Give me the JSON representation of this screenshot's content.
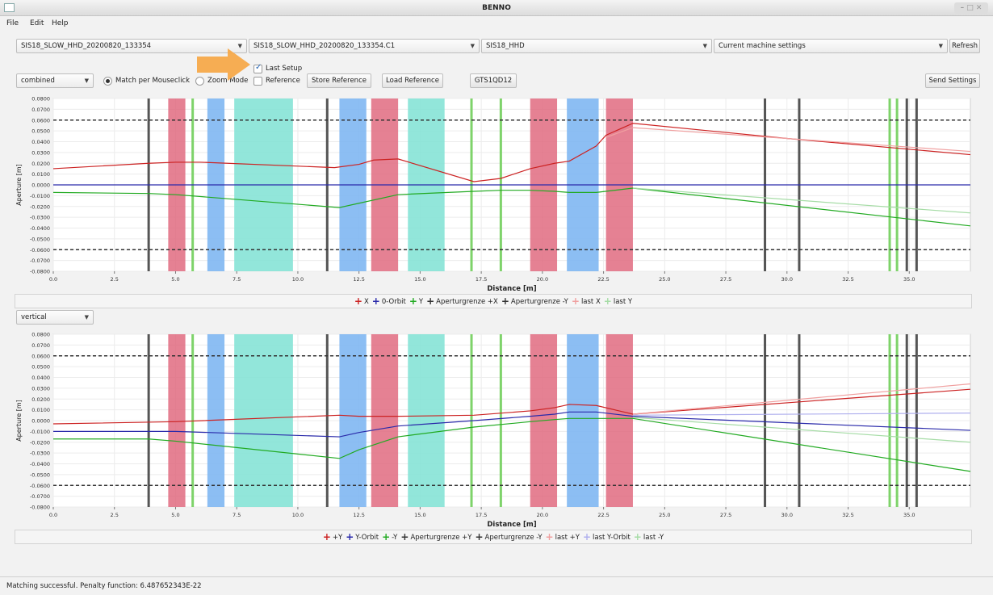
{
  "window": {
    "title": "BENNO"
  },
  "menu": [
    "File",
    "Edit",
    "Help"
  ],
  "toolbar": {
    "file_select": "SIS18_SLOW_HHD_20200820_133354",
    "record_select": "SIS18_SLOW_HHD_20200820_133354.C1",
    "machine_select": "SIS18_HHD",
    "settings_select": "Current machine settings",
    "refresh": "Refresh",
    "mode_select": "combined",
    "match_mouse": "Match per Mouseclick",
    "zoom_mode": "Zoom Mode",
    "last_setup": "Last Setup",
    "reference": "Reference",
    "store_reference": "Store Reference",
    "load_reference": "Load Reference",
    "element": "GTS1QD12",
    "send_settings": "Send Settings"
  },
  "colors": {
    "dipole": "#e06b80",
    "quad_focus": "#7fb7f2",
    "quad_other": "#86e3d6",
    "sextupole": "#7ed36a",
    "marker": "#555555",
    "red": "#cc2222",
    "blue": "#2a2aaa",
    "green": "#22aa22"
  },
  "elements": {
    "dipoles": [
      [
        4.7,
        5.4
      ],
      [
        13.0,
        14.1
      ],
      [
        19.5,
        20.6
      ],
      [
        22.6,
        23.7
      ]
    ],
    "quads_blue": [
      [
        6.3,
        7.0
      ],
      [
        11.7,
        12.8
      ],
      [
        21.0,
        22.3
      ]
    ],
    "quads_teal": [
      [
        7.4,
        9.8
      ],
      [
        14.5,
        16.0
      ]
    ],
    "sextupoles": [
      5.7,
      17.1,
      18.3,
      34.2,
      34.5
    ],
    "markers": [
      3.9,
      11.2,
      29.1,
      30.5,
      34.9,
      35.3
    ]
  },
  "horizontal": {
    "xlabel": "Distance [m]",
    "ylabel": "Aperture [m]",
    "xlim": [
      0,
      37.5
    ],
    "ylim": [
      -0.08,
      0.08
    ],
    "aperture": 0.06,
    "series": [
      {
        "name": "X",
        "color": "#cc2222",
        "x": [
          0,
          3.9,
          5,
          6,
          11.5,
          12.5,
          13.1,
          14.1,
          17.2,
          18.3,
          19.5,
          20.5,
          21.1,
          22.2,
          22.6,
          23.7,
          30,
          37.5
        ],
        "y": [
          0.015,
          0.02,
          0.021,
          0.021,
          0.016,
          0.019,
          0.023,
          0.024,
          0.003,
          0.006,
          0.015,
          0.02,
          0.022,
          0.036,
          0.046,
          0.057,
          0.043,
          0.028
        ]
      },
      {
        "name": "0-Orbit",
        "color": "#2a2aaa",
        "x": [
          0,
          37.5
        ],
        "y": [
          0,
          0
        ]
      },
      {
        "name": "Y",
        "color": "#22aa22",
        "x": [
          0,
          3.9,
          5,
          11.7,
          12.5,
          14.1,
          17.2,
          18.3,
          19.5,
          20.5,
          21.1,
          22.2,
          23.7,
          37.5
        ],
        "y": [
          -0.007,
          -0.008,
          -0.009,
          -0.021,
          -0.017,
          -0.009,
          -0.006,
          -0.005,
          -0.005,
          -0.006,
          -0.007,
          -0.007,
          -0.003,
          -0.038
        ]
      },
      {
        "name": "Aperturgrenze +X",
        "color": "#333333",
        "x": [
          0,
          37.5
        ],
        "y": [
          0.06,
          0.06
        ]
      },
      {
        "name": "Aperturgrenze -Y",
        "color": "#333333",
        "x": [
          0,
          37.5
        ],
        "y": [
          -0.06,
          -0.06
        ]
      },
      {
        "name": "last X",
        "color": "#f0a0a0",
        "x": [
          22.6,
          23.7,
          37.5
        ],
        "y": [
          0.044,
          0.053,
          0.031
        ]
      },
      {
        "name": "last Y",
        "color": "#a6dca6",
        "x": [
          23.7,
          37.5
        ],
        "y": [
          -0.003,
          -0.026
        ]
      }
    ],
    "legend": [
      "X",
      "0-Orbit",
      "Y",
      "Aperturgrenze +X",
      "Aperturgrenze -Y",
      "last X",
      "last Y"
    ]
  },
  "vertical": {
    "mode_select": "vertical",
    "xlabel": "Distance [m]",
    "ylabel": "Aperture [m]",
    "xlim": [
      0,
      37.5
    ],
    "ylim": [
      -0.08,
      0.08
    ],
    "aperture": 0.06,
    "series": [
      {
        "name": "+Y",
        "color": "#cc2222",
        "x": [
          0,
          5,
          11.7,
          12.5,
          14.1,
          17.2,
          19.5,
          20.5,
          21.1,
          22.2,
          23.7,
          37.5
        ],
        "y": [
          -0.003,
          -0.001,
          0.005,
          0.004,
          0.004,
          0.005,
          0.009,
          0.012,
          0.015,
          0.014,
          0.006,
          0.029
        ]
      },
      {
        "name": "Y-Orbit",
        "color": "#2a2aaa",
        "x": [
          0,
          5,
          11.7,
          12.5,
          14.1,
          17.2,
          19.5,
          20.5,
          21.1,
          22.2,
          23.7,
          37.5
        ],
        "y": [
          -0.01,
          -0.01,
          -0.015,
          -0.011,
          -0.005,
          0.0,
          0.004,
          0.006,
          0.008,
          0.008,
          0.004,
          -0.009
        ]
      },
      {
        "name": "-Y",
        "color": "#22aa22",
        "x": [
          0,
          3.9,
          5,
          11.7,
          12.5,
          14.1,
          17.2,
          19.5,
          20.5,
          21.1,
          23.7,
          37.5
        ],
        "y": [
          -0.017,
          -0.017,
          -0.019,
          -0.035,
          -0.027,
          -0.015,
          -0.006,
          -0.001,
          0.001,
          0.002,
          0.002,
          -0.047
        ]
      },
      {
        "name": "Aperturgrenze +Y",
        "color": "#333333",
        "x": [
          0,
          37.5
        ],
        "y": [
          0.06,
          0.06
        ]
      },
      {
        "name": "Aperturgrenze -Y",
        "color": "#333333",
        "x": [
          0,
          37.5
        ],
        "y": [
          -0.06,
          -0.06
        ]
      },
      {
        "name": "last +Y",
        "color": "#f0a0a0",
        "x": [
          23.7,
          37.5
        ],
        "y": [
          0.006,
          0.034
        ]
      },
      {
        "name": "last Y-Orbit",
        "color": "#b0b0ee",
        "x": [
          23.7,
          37.5
        ],
        "y": [
          0.005,
          0.007
        ]
      },
      {
        "name": "last -Y",
        "color": "#a6dca6",
        "x": [
          23.7,
          37.5
        ],
        "y": [
          0.003,
          -0.02
        ]
      }
    ],
    "legend": [
      "+Y",
      "Y-Orbit",
      "-Y",
      "Aperturgrenze +Y",
      "Aperturgrenze -Y",
      "last +Y",
      "last Y-Orbit",
      "last -Y"
    ]
  },
  "axis": {
    "xticks": [
      0.0,
      2.5,
      5.0,
      7.5,
      10.0,
      12.5,
      15.0,
      17.5,
      20.0,
      22.5,
      25.0,
      27.5,
      30.0,
      32.5,
      35.0
    ],
    "yticks": [
      "0.0800",
      "0.0700",
      "0.0600",
      "0.0500",
      "0.0400",
      "0.0300",
      "0.0200",
      "0.0100",
      "0.0000",
      "-0.0100",
      "-0.0200",
      "-0.0300",
      "-0.0400",
      "-0.0500",
      "-0.0600",
      "-0.0700",
      "-0.0800"
    ]
  },
  "status": "Matching successful. Penalty function: 6.487652343E-22"
}
